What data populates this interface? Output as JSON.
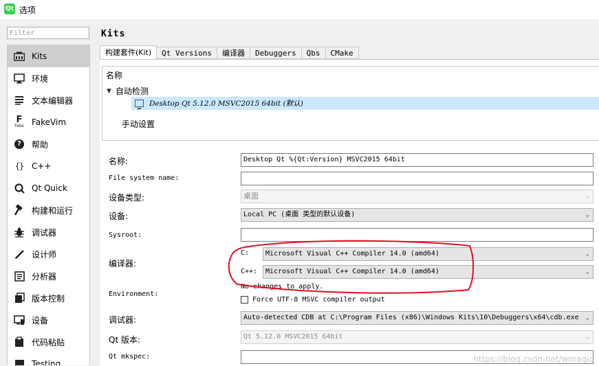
{
  "window": {
    "title": "选项",
    "icon_text": "Qt"
  },
  "filter": {
    "placeholder": "Filter"
  },
  "sidebar": {
    "items": [
      {
        "label": "Kits",
        "icon": "kits-icon",
        "selected": true
      },
      {
        "label": "环境",
        "icon": "monitor-icon"
      },
      {
        "label": "文本编辑器",
        "icon": "text-editor-icon"
      },
      {
        "label": "FakeVim",
        "icon": "fakevim-icon",
        "icon_text": "Fake"
      },
      {
        "label": "帮助",
        "icon": "help-icon",
        "icon_text": "?"
      },
      {
        "label": "C++",
        "icon": "braces-icon",
        "icon_text": "{}"
      },
      {
        "label": "Qt Quick",
        "icon": "qt-quick-icon"
      },
      {
        "label": "构建和运行",
        "icon": "hammer-icon"
      },
      {
        "label": "调试器",
        "icon": "bug-icon"
      },
      {
        "label": "设计师",
        "icon": "pencil-icon"
      },
      {
        "label": "分析器",
        "icon": "analyzer-icon"
      },
      {
        "label": "版本控制",
        "icon": "version-control-icon"
      },
      {
        "label": "设备",
        "icon": "device-icon"
      },
      {
        "label": "代码粘贴",
        "icon": "paste-icon"
      },
      {
        "label": "Testing",
        "icon": "testing-icon"
      }
    ]
  },
  "main": {
    "title": "Kits",
    "tabs": [
      {
        "label": "构建套件(Kit)",
        "active": true
      },
      {
        "label": "Qt Versions"
      },
      {
        "label": "编译器"
      },
      {
        "label": "Debuggers"
      },
      {
        "label": "Qbs"
      },
      {
        "label": "CMake"
      }
    ],
    "tree": {
      "header": "名称",
      "group_auto": "自动检测",
      "selected_kit": "Desktop Qt 5.12.0 MSVC2015 64bit (默认)",
      "group_manual": "手动设置"
    },
    "form": {
      "name_label": "名称:",
      "name_value": "Desktop Qt %{Qt:Version} MSVC2015 64bit",
      "fs_label": "File system name:",
      "fs_value": "",
      "device_type_label": "设备类型:",
      "device_type_value": "桌面",
      "device_label": "设备:",
      "device_value": "Local PC (桌面 类型的默认设备)",
      "sysroot_label": "Sysroot:",
      "sysroot_value": "",
      "compiler_label": "编译器:",
      "compiler_c_label": "C:",
      "compiler_c_value": "Microsoft Visual C++ Compiler 14.0 (amd64)",
      "compiler_cpp_label": "C++:",
      "compiler_cpp_value": "Microsoft Visual C++ Compiler 14.0 (amd64)",
      "env_label": "Environment:",
      "env_value": "No changes to apply.",
      "force_utf8_label": "Force UTF-8 MSVC compiler output",
      "debugger_label": "调试器:",
      "debugger_value": "Auto-detected CDB at C:\\Program Files (x86)\\Windows Kits\\10\\Debuggers\\x64\\cdb.exe",
      "qt_version_label": "Qt 版本:",
      "qt_version_value": "Qt 5.12.0 MSVC2015 64bit",
      "mkspec_label": "Qt mkspec:",
      "mkspec_value": ""
    }
  },
  "watermark": "https://blog.csdn.net/wmagic",
  "colors": {
    "selection": "#cce8ff",
    "annotation": "#e0101a",
    "sidebar_selected": "#cfcfcf"
  }
}
